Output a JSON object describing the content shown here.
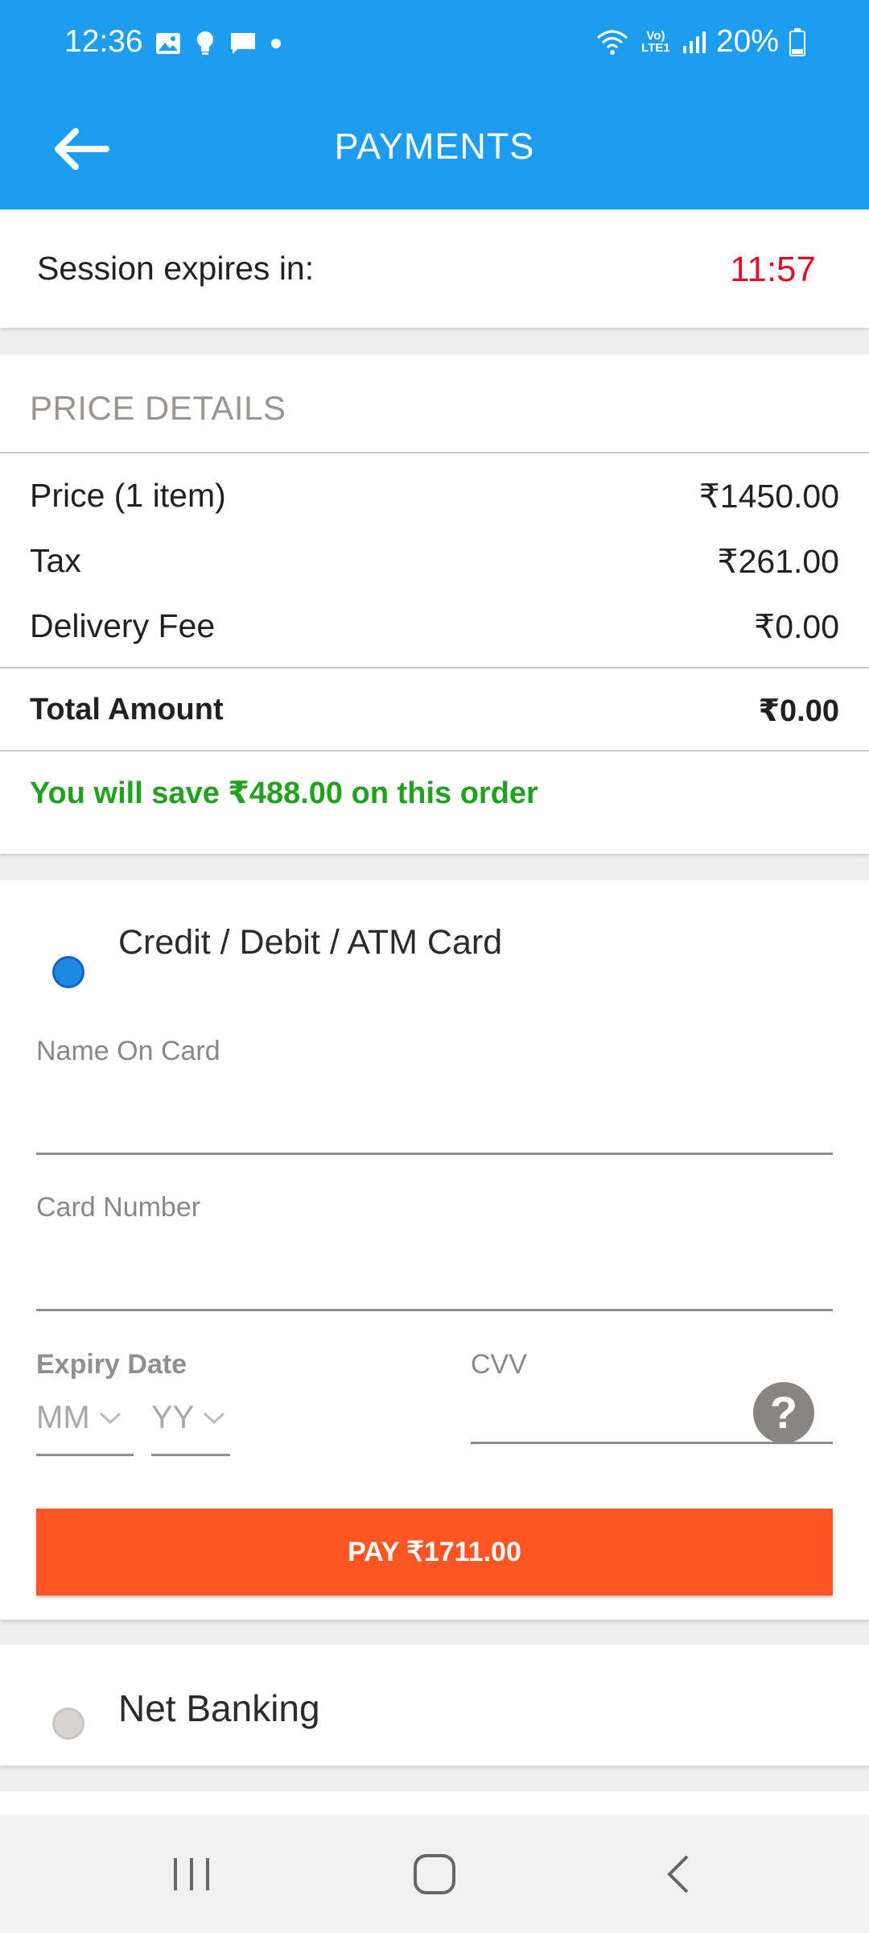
{
  "status_bar": {
    "time": "12:36",
    "battery": "20%",
    "network": "Vo) LTE1"
  },
  "app_bar": {
    "title": "PAYMENTS"
  },
  "session": {
    "label": "Session expires in:",
    "timer": "11:57"
  },
  "price_details": {
    "header": "PRICE DETAILS",
    "rows": [
      {
        "label": "Price (1 item)",
        "value": "₹1450.00"
      },
      {
        "label": "Tax",
        "value": "₹261.00"
      },
      {
        "label": "Delivery Fee",
        "value": "₹0.00"
      }
    ],
    "total": {
      "label": "Total Amount",
      "value": "₹0.00"
    },
    "savings": "You will save ₹488.00 on this order"
  },
  "card_payment": {
    "label": "Credit / Debit / ATM Card",
    "name_label": "Name On Card",
    "number_label": "Card Number",
    "expiry_label": "Expiry Date",
    "month_placeholder": "MM",
    "year_placeholder": "YY",
    "cvv_label": "CVV",
    "help": "?",
    "pay_button": "PAY ₹1711.00"
  },
  "net_banking": {
    "label": "Net Banking"
  },
  "colors": {
    "accent": "#1e9cf0",
    "pay_button": "#fd5524",
    "timer": "#e0102a",
    "savings": "#22a11f"
  }
}
